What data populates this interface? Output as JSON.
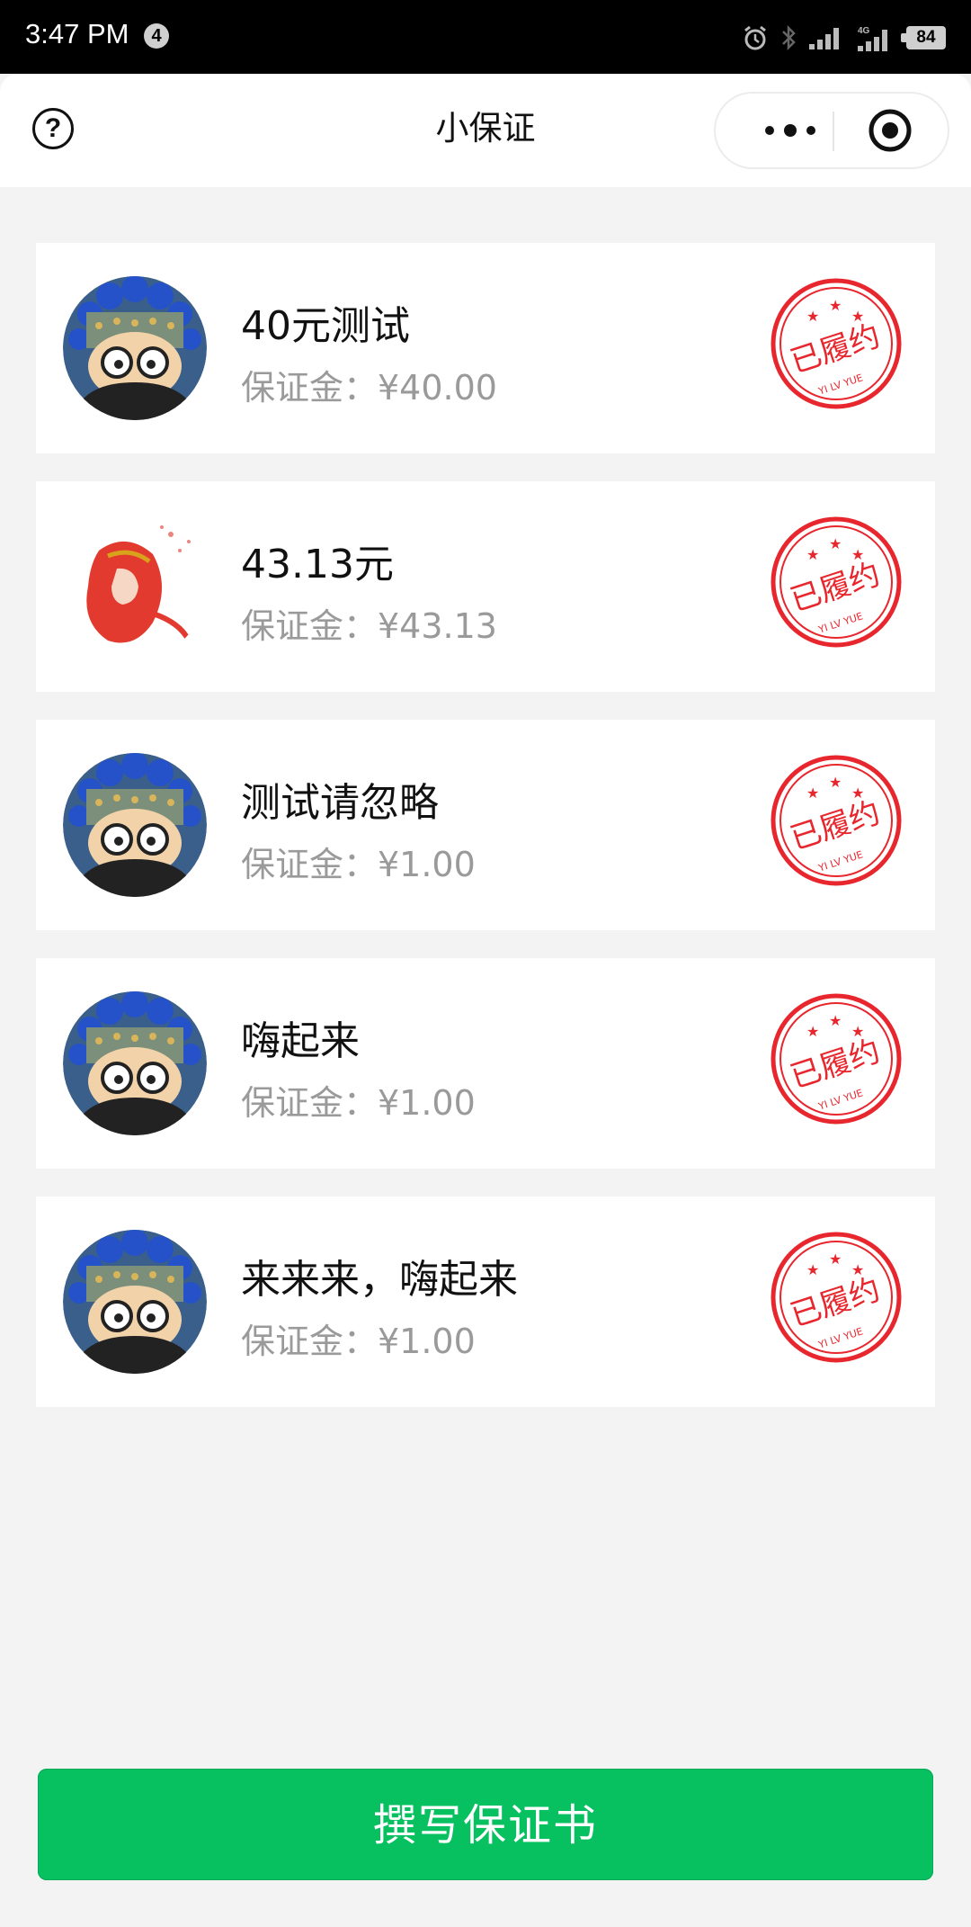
{
  "status_bar": {
    "time": "3:47 PM",
    "notification_count": "4",
    "battery": "84",
    "network_type": "4G",
    "icons": [
      "alarm-icon",
      "bluetooth-icon",
      "signal-icon",
      "signal-4g-icon",
      "battery-icon"
    ]
  },
  "navbar": {
    "title": "小保证",
    "help_icon": "question-circle-icon",
    "menu_icon": "more-dots-icon",
    "close_icon": "target-close-icon"
  },
  "cards": [
    {
      "title": "40元测试",
      "deposit": "保证金：¥40.00",
      "avatar": "opera-cartoon-avatar",
      "stamp": "已履约"
    },
    {
      "title": "43.13元",
      "deposit": "保证金：¥43.13",
      "avatar": "red-hair-girl-avatar",
      "stamp": "已履约"
    },
    {
      "title": "测试请忽略",
      "deposit": "保证金：¥1.00",
      "avatar": "opera-cartoon-avatar",
      "stamp": "已履约"
    },
    {
      "title": "嗨起来",
      "deposit": "保证金：¥1.00",
      "avatar": "opera-cartoon-avatar",
      "stamp": "已履约"
    },
    {
      "title": "来来来，嗨起来",
      "deposit": "保证金：¥1.00",
      "avatar": "opera-cartoon-avatar",
      "stamp": "已履约"
    }
  ],
  "stamp": {
    "label": "已履约",
    "sublabel": "YI LV YUE",
    "color": "#e8262d"
  },
  "write_button": {
    "label": "撰写保证书",
    "color": "#07c160"
  }
}
